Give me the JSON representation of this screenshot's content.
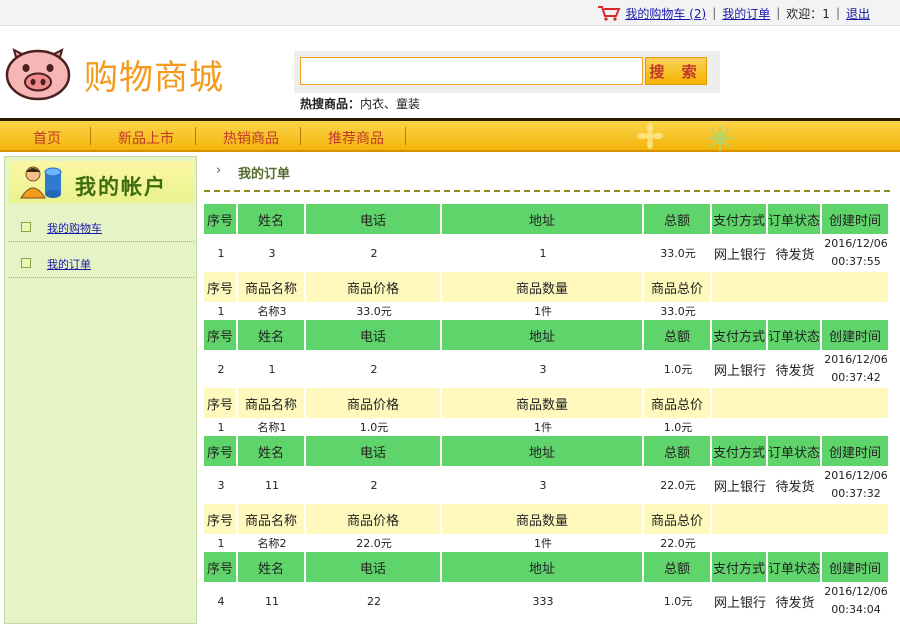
{
  "topbar": {
    "cart_label": "我的购物车 (2)",
    "orders_label": "我的订单",
    "welcome": "欢迎：1",
    "logout_label": "退出"
  },
  "header": {
    "brand": "购物商城",
    "search_placeholder": "",
    "search_button": "搜 索",
    "hot_label": "热搜商品：",
    "hot_items": "内衣、童装"
  },
  "nav": {
    "items": [
      "首页",
      "新品上市",
      "热销商品",
      "推荐商品"
    ]
  },
  "sidebar": {
    "title": "我的帐户",
    "items": [
      "我的购物车",
      "我的订单"
    ]
  },
  "main": {
    "breadcrumb_arrow": "›",
    "breadcrumb": "我的订单",
    "order_headers": [
      "序号",
      "姓名",
      "电话",
      "地址",
      "总额",
      "支付方式",
      "订单状态",
      "创建时间"
    ],
    "item_headers": [
      "序号",
      "商品名称",
      "商品价格",
      "商品数量",
      "商品总价"
    ],
    "orders": [
      {
        "no": "1",
        "name": "3",
        "phone": "2",
        "address": "1",
        "total": "33.0元",
        "pay": "网上银行",
        "status": "待发货",
        "date": "2016/12/06",
        "time": "00:37:55",
        "item": {
          "no": "1",
          "name": "名称3",
          "price": "33.0元",
          "qty": "1件",
          "sum": "33.0元"
        }
      },
      {
        "no": "2",
        "name": "1",
        "phone": "2",
        "address": "3",
        "total": "1.0元",
        "pay": "网上银行",
        "status": "待发货",
        "date": "2016/12/06",
        "time": "00:37:42",
        "item": {
          "no": "1",
          "name": "名称1",
          "price": "1.0元",
          "qty": "1件",
          "sum": "1.0元"
        }
      },
      {
        "no": "3",
        "name": "11",
        "phone": "2",
        "address": "3",
        "total": "22.0元",
        "pay": "网上银行",
        "status": "待发货",
        "date": "2016/12/06",
        "time": "00:37:32",
        "item": {
          "no": "1",
          "name": "名称2",
          "price": "22.0元",
          "qty": "1件",
          "sum": "22.0元"
        }
      },
      {
        "no": "4",
        "name": "11",
        "phone": "22",
        "address": "333",
        "total": "1.0元",
        "pay": "网上银行",
        "status": "待发货",
        "date": "2016/12/06",
        "time": "00:34:04"
      }
    ]
  },
  "colors": {
    "accent": "#f39a1f",
    "order_header": "#5fd46a",
    "item_header": "#fff9bd",
    "nav": "#f3b50c",
    "sidebar": "#e5f3c7"
  },
  "icons": [
    "cart-icon",
    "pig-logo-icon",
    "user-coins-icon",
    "flower-icon"
  ]
}
